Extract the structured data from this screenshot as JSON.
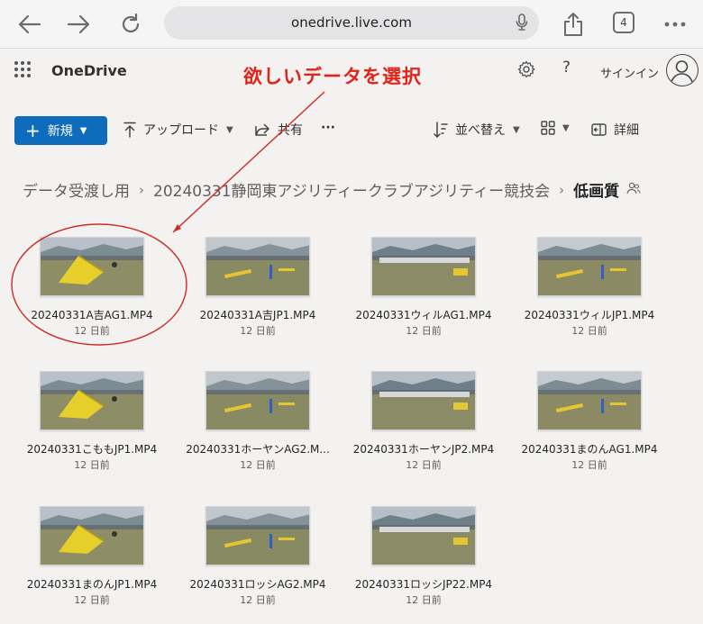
{
  "browser": {
    "url": "onedrive.live.com",
    "tab_count": "4",
    "icons": [
      "back-icon",
      "forward-icon",
      "reload-icon",
      "mic-icon",
      "share-icon",
      "tabs-icon",
      "more-icon"
    ]
  },
  "app": {
    "brand": "OneDrive",
    "annotation": "欲しいデータを選択",
    "help": "?",
    "signin": "サインイン",
    "annotation_color": "#e2231a",
    "accent": "#0f6cbd"
  },
  "commands": {
    "new": "新規",
    "upload": "アップロード",
    "share": "共有",
    "more": "···",
    "sort": "並べ替え",
    "details": "詳細"
  },
  "breadcrumb": {
    "items": [
      "データ受渡し用",
      "20240331静岡東アジリティークラブアジリティー競技会"
    ],
    "current": "低画質"
  },
  "files": [
    {
      "name": "20240331A吉AG1.MP4",
      "date": "12 日前"
    },
    {
      "name": "20240331A吉JP1.MP4",
      "date": "12 日前"
    },
    {
      "name": "20240331ウィルAG1.MP4",
      "date": "12 日前"
    },
    {
      "name": "20240331ウィルJP1.MP4",
      "date": "12 日前"
    },
    {
      "name": "20240331こももJP1.MP4",
      "date": "12 日前"
    },
    {
      "name": "20240331ホーヤンAG2.M...",
      "date": "12 日前"
    },
    {
      "name": "20240331ホーヤンJP2.MP4",
      "date": "12 日前"
    },
    {
      "name": "20240331まのんAG1.MP4",
      "date": "12 日前"
    },
    {
      "name": "20240331まのんJP1.MP4",
      "date": "12 日前"
    },
    {
      "name": "20240331ロッシAG2.MP4",
      "date": "12 日前"
    },
    {
      "name": "20240331ロッシJP22.MP4",
      "date": "12 日前"
    }
  ]
}
